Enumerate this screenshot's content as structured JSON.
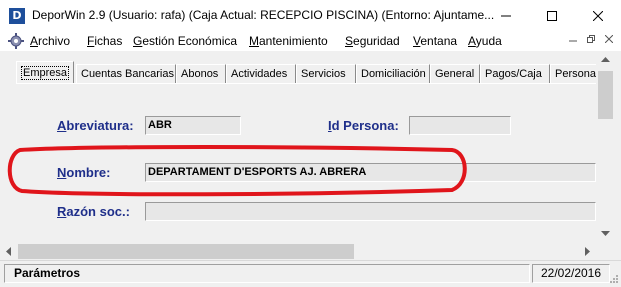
{
  "window": {
    "icon_letter": "D",
    "title": "DeporWin 2.9  (Usuario: rafa)  (Caja Actual: RECEPCIO PISCINA) (Entorno: Ajuntame..."
  },
  "menu": {
    "items": [
      "Archivo",
      "Fichas",
      "Gestión Económica",
      "Mantenimiento",
      "Seguridad",
      "Ventana",
      "Ayuda"
    ]
  },
  "tabs": [
    "Empresa",
    "Cuentas Bancarias",
    "Abonos",
    "Actividades",
    "Servicios",
    "Domiciliación",
    "General",
    "Pagos/Caja",
    "Persona"
  ],
  "form": {
    "abreviatura_label": "Abreviatura:",
    "abreviatura_value": "ABR",
    "id_persona_label": "Id Persona:",
    "id_persona_value": "",
    "nombre_label": "Nombre:",
    "nombre_value": "DEPARTAMENT D'ESPORTS AJ. ABRERA",
    "razon_social_label": "Razón soc.:",
    "razon_social_value": ""
  },
  "annotation": {
    "color": "#e0151b"
  },
  "status": {
    "left": "Parámetros",
    "date": "22/02/2016"
  }
}
